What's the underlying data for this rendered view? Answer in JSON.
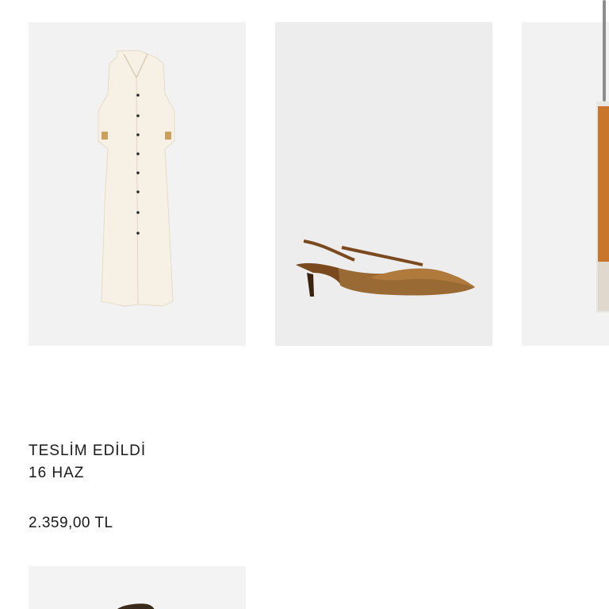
{
  "order": {
    "status_label": "TESLİM EDİLDİ",
    "date_label": "16 HAZ",
    "price_label": "2.359,00 TL"
  },
  "products": [
    {
      "icon": "dress-image"
    },
    {
      "icon": "slingback-shoe-image"
    },
    {
      "icon": "perfume-bottle-image"
    },
    {
      "icon": "next-product-image"
    }
  ],
  "colors": {
    "tile_bg": "#f2f2f2",
    "dress": "#f6f1e4",
    "shoe": "#8a5a28",
    "perfume": "#c9762a"
  }
}
